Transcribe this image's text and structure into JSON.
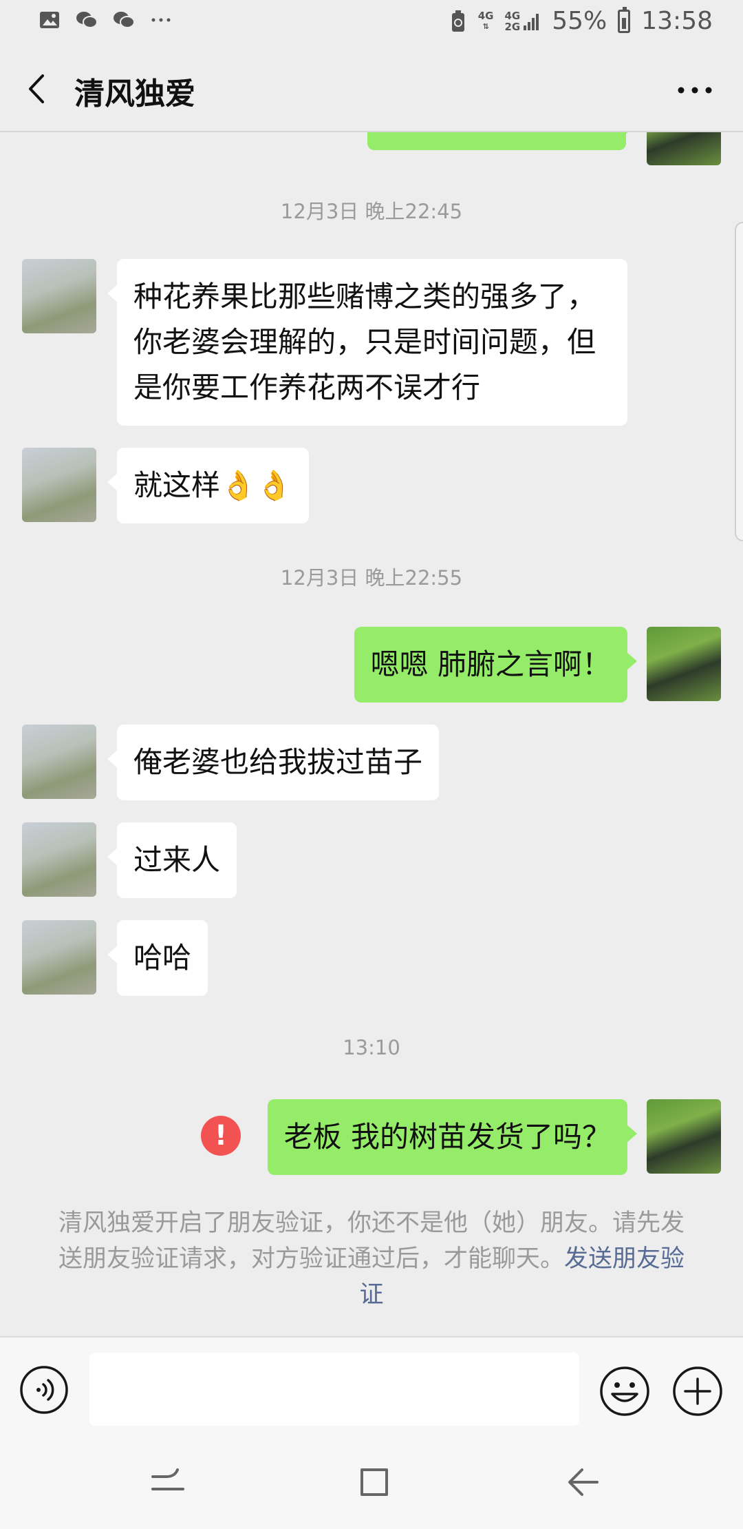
{
  "status_bar": {
    "net1": "4G",
    "net2_top": "4G",
    "net2_bottom": "2G",
    "battery": "55%",
    "time": "13:58"
  },
  "header": {
    "title": "清风独爱"
  },
  "messages": {
    "ts1": "12月3日 晚上22:45",
    "m1": "种花养果比那些赌博之类的强多了，你老婆会理解的，只是时间问题，但是你要工作养花两不误才行",
    "m2": "就这样👌👌",
    "ts2": "12月3日 晚上22:55",
    "m3": "嗯嗯  肺腑之言啊！",
    "m4": "俺老婆也给我拔过苗子",
    "m5": "过来人",
    "m6": "哈哈",
    "ts3": "13:10",
    "m7": "老板  我的树苗发货了吗？",
    "fail_mark": "!"
  },
  "notice": {
    "text": "清风独爱开启了朋友验证，你还不是他（她）朋友。请先发送朋友验证请求，对方验证通过后，才能聊天。",
    "link": "发送朋友验证"
  },
  "colors": {
    "my_bubble": "#95ec69",
    "their_bubble": "#ffffff",
    "link": "#576b95",
    "error": "#f25252",
    "background": "#ededed"
  },
  "icons": {
    "back": "chevron-left-icon",
    "more": "ellipsis-icon",
    "voice": "voice-icon",
    "emoji": "emoji-icon",
    "plus": "plus-icon"
  }
}
